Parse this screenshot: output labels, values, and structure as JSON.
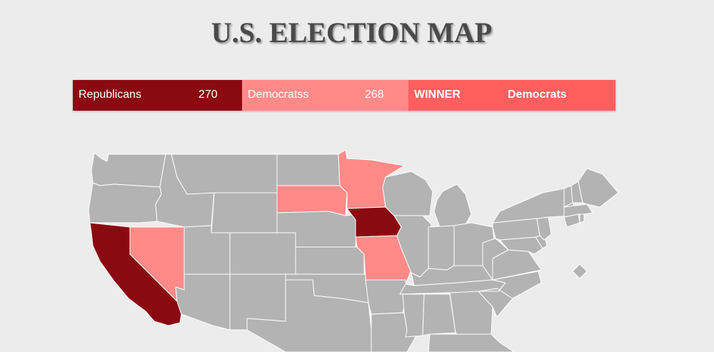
{
  "title": "U.S. ELECTION MAP",
  "scoreboard": {
    "republicans": {
      "label": "Republicans",
      "votes": "270",
      "color": "#8b0a12"
    },
    "democrats": {
      "label": "Democratss",
      "votes": "268",
      "color": "#ff8a88"
    },
    "winner": {
      "label": "WINNER",
      "name": "Democrats",
      "color": "#ff5f5f"
    }
  },
  "map": {
    "colors": {
      "default": "#b3b3b3",
      "republican": "#8b0a12",
      "democrat": "#ff8a88",
      "border": "#ffffff"
    },
    "states": [
      {
        "name": "Washington",
        "party": "none"
      },
      {
        "name": "Oregon",
        "party": "none"
      },
      {
        "name": "California",
        "party": "republican"
      },
      {
        "name": "Nevada",
        "party": "democrat"
      },
      {
        "name": "Idaho",
        "party": "none"
      },
      {
        "name": "Montana",
        "party": "none"
      },
      {
        "name": "Wyoming",
        "party": "none"
      },
      {
        "name": "Utah",
        "party": "none"
      },
      {
        "name": "Arizona",
        "party": "none"
      },
      {
        "name": "Colorado",
        "party": "none"
      },
      {
        "name": "New Mexico",
        "party": "none"
      },
      {
        "name": "North Dakota",
        "party": "none"
      },
      {
        "name": "South Dakota",
        "party": "democrat"
      },
      {
        "name": "Nebraska",
        "party": "none"
      },
      {
        "name": "Kansas",
        "party": "none"
      },
      {
        "name": "Oklahoma",
        "party": "none"
      },
      {
        "name": "Texas",
        "party": "none"
      },
      {
        "name": "Minnesota",
        "party": "democrat"
      },
      {
        "name": "Iowa",
        "party": "republican"
      },
      {
        "name": "Missouri",
        "party": "democrat"
      },
      {
        "name": "Arkansas",
        "party": "none"
      },
      {
        "name": "Louisiana",
        "party": "none"
      },
      {
        "name": "Wisconsin",
        "party": "none"
      },
      {
        "name": "Michigan",
        "party": "none"
      },
      {
        "name": "Illinois",
        "party": "none"
      },
      {
        "name": "Indiana",
        "party": "none"
      },
      {
        "name": "Ohio",
        "party": "none"
      },
      {
        "name": "Kentucky",
        "party": "none"
      },
      {
        "name": "Tennessee",
        "party": "none"
      },
      {
        "name": "Mississippi",
        "party": "none"
      },
      {
        "name": "Alabama",
        "party": "none"
      },
      {
        "name": "Georgia",
        "party": "none"
      },
      {
        "name": "South Carolina",
        "party": "none"
      },
      {
        "name": "North Carolina",
        "party": "none"
      },
      {
        "name": "Virginia",
        "party": "none"
      },
      {
        "name": "West Virginia",
        "party": "none"
      },
      {
        "name": "Maryland",
        "party": "none"
      },
      {
        "name": "Delaware",
        "party": "none"
      },
      {
        "name": "Pennsylvania",
        "party": "none"
      },
      {
        "name": "New Jersey",
        "party": "none"
      },
      {
        "name": "New York",
        "party": "none"
      },
      {
        "name": "Connecticut",
        "party": "none"
      },
      {
        "name": "Rhode Island",
        "party": "none"
      },
      {
        "name": "Massachusetts",
        "party": "none"
      },
      {
        "name": "Vermont",
        "party": "none"
      },
      {
        "name": "New Hampshire",
        "party": "none"
      },
      {
        "name": "Maine",
        "party": "none"
      },
      {
        "name": "District of Columbia",
        "party": "none"
      },
      {
        "name": "Florida",
        "party": "none"
      }
    ]
  }
}
